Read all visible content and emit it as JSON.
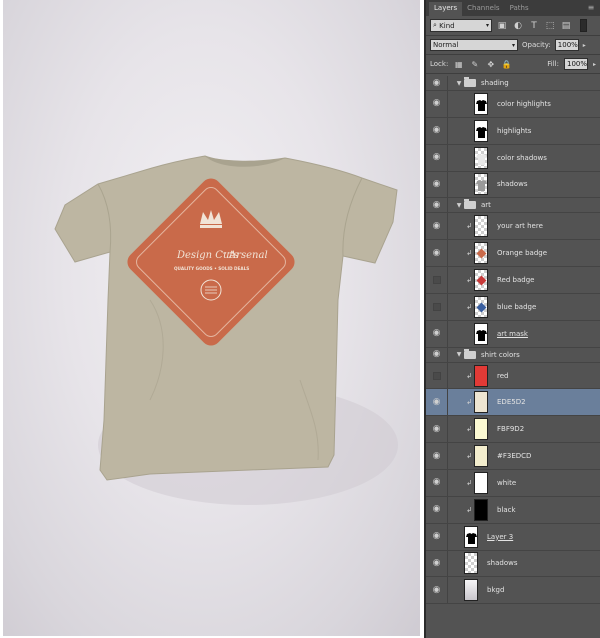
{
  "panel": {
    "tabs": [
      "Layers",
      "Channels",
      "Paths"
    ],
    "filter": {
      "kind_label": "Kind"
    },
    "blend_mode": "Normal",
    "opacity_label": "Opacity:",
    "opacity_value": "100%",
    "lock_label": "Lock:",
    "fill_label": "Fill:",
    "fill_value": "100%"
  },
  "layers": [
    {
      "name": "shading",
      "type": "group",
      "visible": true,
      "depth": 0
    },
    {
      "name": "color highlights",
      "type": "layer",
      "visible": true,
      "depth": 1,
      "thumb": "tee-black"
    },
    {
      "name": "highlights",
      "type": "layer",
      "visible": true,
      "depth": 1,
      "thumb": "tee-black"
    },
    {
      "name": "color shadows",
      "type": "layer",
      "visible": true,
      "depth": 1,
      "thumb": "tee-white"
    },
    {
      "name": "shadows",
      "type": "layer",
      "visible": true,
      "depth": 1,
      "thumb": "tee-gray"
    },
    {
      "name": "art",
      "type": "group",
      "visible": true,
      "depth": 0
    },
    {
      "name": "your art here",
      "type": "layer",
      "visible": true,
      "depth": 1,
      "clipped": true,
      "thumb": "checker"
    },
    {
      "name": "Orange badge",
      "type": "layer",
      "visible": true,
      "depth": 1,
      "clipped": true,
      "thumb": "badge",
      "thumb_color": "#c96a4a"
    },
    {
      "name": "Red badge",
      "type": "layer",
      "visible": false,
      "depth": 1,
      "clipped": true,
      "thumb": "badge",
      "thumb_color": "#c83a3a"
    },
    {
      "name": "blue badge",
      "type": "layer",
      "visible": false,
      "depth": 1,
      "clipped": true,
      "thumb": "badge",
      "thumb_color": "#3a5fa0"
    },
    {
      "name": "art mask",
      "type": "layer",
      "visible": true,
      "depth": 1,
      "thumb": "tee-black",
      "underline": true
    },
    {
      "name": "shirt colors",
      "type": "group",
      "visible": true,
      "depth": 0
    },
    {
      "name": "red",
      "type": "layer",
      "visible": false,
      "depth": 1,
      "clipped": true,
      "thumb": "solid",
      "thumb_color": "#e23a36"
    },
    {
      "name": "EDE5D2",
      "type": "layer",
      "visible": true,
      "depth": 1,
      "clipped": true,
      "thumb": "solid",
      "thumb_color": "#ede5d2",
      "selected": true
    },
    {
      "name": "FBF9D2",
      "type": "layer",
      "visible": true,
      "depth": 1,
      "clipped": true,
      "thumb": "solid",
      "thumb_color": "#fbf9d2"
    },
    {
      "name": "#F3EDCD",
      "type": "layer",
      "visible": true,
      "depth": 1,
      "clipped": true,
      "thumb": "solid",
      "thumb_color": "#f3edcd"
    },
    {
      "name": "white",
      "type": "layer",
      "visible": true,
      "depth": 1,
      "clipped": true,
      "thumb": "solid",
      "thumb_color": "#ffffff"
    },
    {
      "name": "black",
      "type": "layer",
      "visible": true,
      "depth": 1,
      "clipped": true,
      "thumb": "solid",
      "thumb_color": "#000000"
    },
    {
      "name": "Layer 3",
      "type": "layer",
      "visible": true,
      "depth": 0,
      "thumb": "tee-black",
      "underline": true
    },
    {
      "name": "shadows",
      "type": "layer",
      "visible": true,
      "depth": 0,
      "thumb": "checker"
    },
    {
      "name": "bkgd",
      "type": "layer",
      "visible": true,
      "depth": 0,
      "thumb": "gradient"
    }
  ],
  "artwork": {
    "shirt_color": "#bdb6a2",
    "badge_color": "#c96a4a",
    "badge_text_primary": "Design Cuts",
    "badge_text_secondary": "Arsenal",
    "badge_text_small": "AT THE",
    "badge_tagline": "QUALITY GOODS • SOLID DEALS"
  }
}
